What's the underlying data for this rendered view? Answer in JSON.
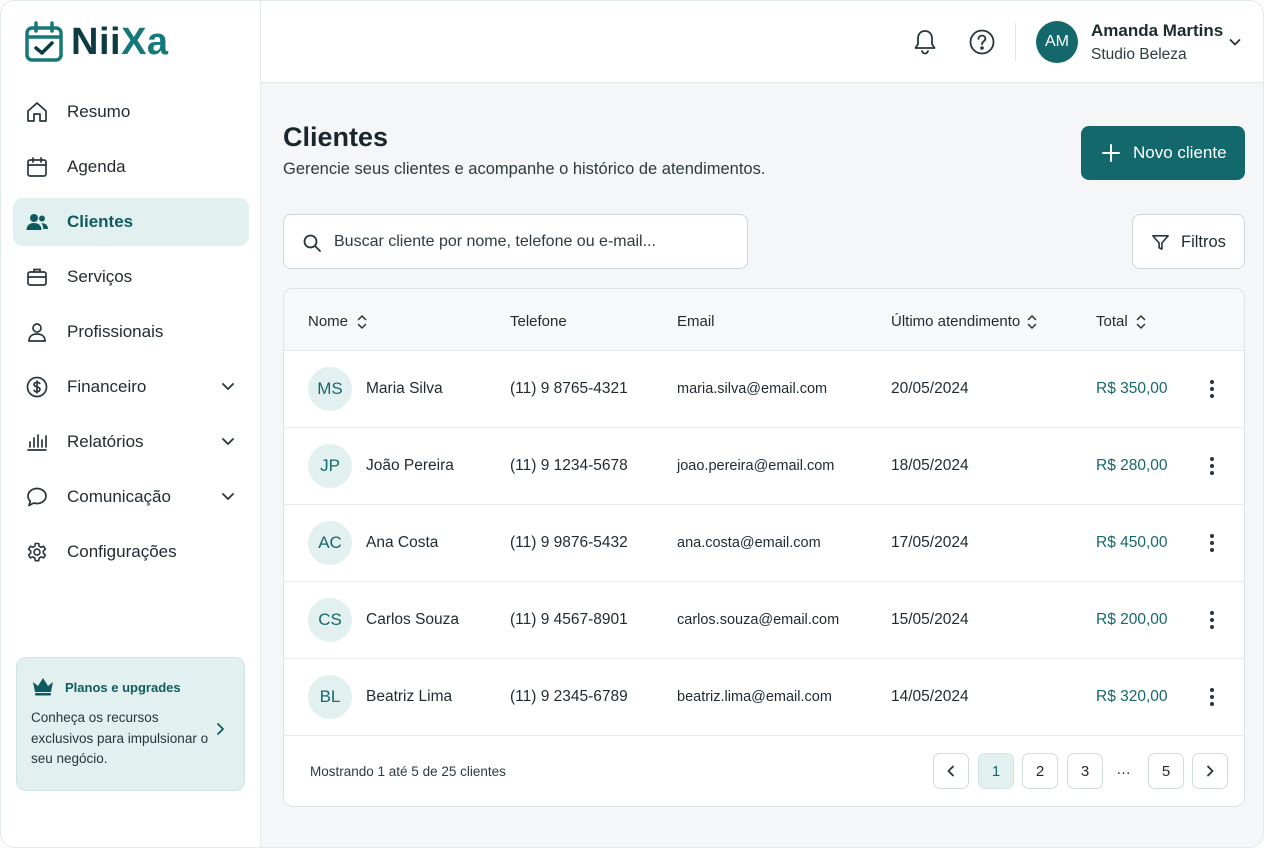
{
  "brand": {
    "name_part1": "Nii",
    "name_part2": "Xa",
    "accent_color": "#12686b"
  },
  "sidebar": {
    "items": [
      {
        "label": "Resumo",
        "icon": "home-icon"
      },
      {
        "label": "Agenda",
        "icon": "calendar-icon"
      },
      {
        "label": "Clientes",
        "icon": "users-icon",
        "active": true
      },
      {
        "label": "Serviços",
        "icon": "briefcase-icon"
      },
      {
        "label": "Profissionais",
        "icon": "user-icon"
      },
      {
        "label": "Financeiro",
        "icon": "dollar-icon",
        "expandable": true
      },
      {
        "label": "Relatórios",
        "icon": "bar-chart-icon",
        "expandable": true
      },
      {
        "label": "Comunicação",
        "icon": "chat-icon",
        "expandable": true
      },
      {
        "label": "Configurações",
        "icon": "gear-icon"
      }
    ],
    "upgrade": {
      "title": "Planos e upgrades",
      "text": "Conheça os recursos exclusivos para impulsionar o seu negócio."
    }
  },
  "header": {
    "user": {
      "initials": "AM",
      "name": "Amanda Martins",
      "business": "Studio Beleza"
    }
  },
  "main": {
    "title": "Clientes",
    "subtitle": "Gerencie seus clientes e acompanhe o histórico de atendimentos.",
    "new_button": "Novo cliente",
    "search_placeholder": "Buscar cliente por nome, telefone ou e-mail...",
    "filters_label": "Filtros",
    "table": {
      "columns": [
        "Nome",
        "Telefone",
        "Email",
        "Último atendimento",
        "Total"
      ],
      "rows": [
        {
          "initials": "MS",
          "name": "Maria Silva",
          "phone": "(11) 9 8765-4321",
          "email": "maria.silva@email.com",
          "last": "20/05/2024",
          "total": "R$ 350,00"
        },
        {
          "initials": "JP",
          "name": "João Pereira",
          "phone": "(11) 9 1234-5678",
          "email": "joao.pereira@email.com",
          "last": "18/05/2024",
          "total": "R$ 280,00"
        },
        {
          "initials": "AC",
          "name": "Ana Costa",
          "phone": "(11) 9 9876-5432",
          "email": "ana.costa@email.com",
          "last": "17/05/2024",
          "total": "R$ 450,00"
        },
        {
          "initials": "CS",
          "name": "Carlos Souza",
          "phone": "(11) 9 4567-8901",
          "email": "carlos.souza@email.com",
          "last": "15/05/2024",
          "total": "R$ 200,00"
        },
        {
          "initials": "BL",
          "name": "Beatriz Lima",
          "phone": "(11) 9 2345-6789",
          "email": "beatriz.lima@email.com",
          "last": "14/05/2024",
          "total": "R$ 320,00"
        }
      ]
    },
    "pagination": {
      "summary": "Mostrando 1 até 5 de 25 clientes",
      "pages": [
        "1",
        "2",
        "3",
        "5"
      ],
      "ellipsis": "…",
      "current": "1"
    }
  }
}
